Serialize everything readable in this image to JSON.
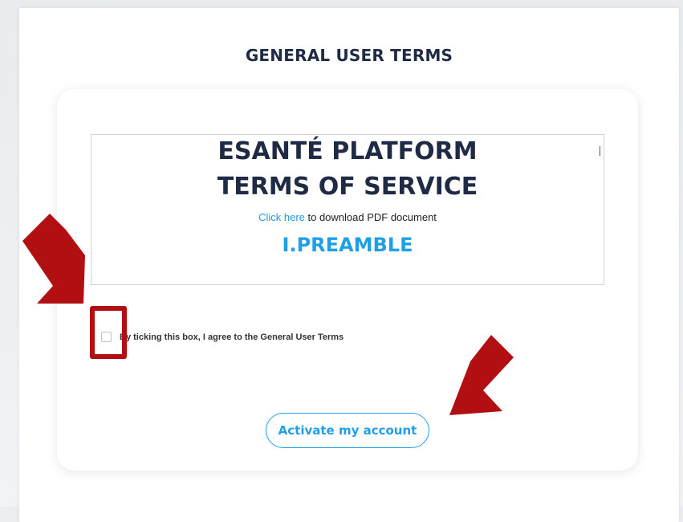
{
  "modal": {
    "title": "GENERAL USER TERMS"
  },
  "document": {
    "title_line1": "ESANTÉ PLATFORM",
    "title_line2": "TERMS OF SERVICE",
    "download_link_text": "Click here",
    "download_suffix": " to download PDF document",
    "section_heading": "I.PREAMBLE"
  },
  "agreement": {
    "label": "By ticking this box, I agree to the General User Terms",
    "checked": false
  },
  "actions": {
    "activate_label": "Activate my account"
  },
  "colors": {
    "accent": "#1f9fe8",
    "title_text": "#1f2a44",
    "annotation_red": "#b10f12"
  }
}
